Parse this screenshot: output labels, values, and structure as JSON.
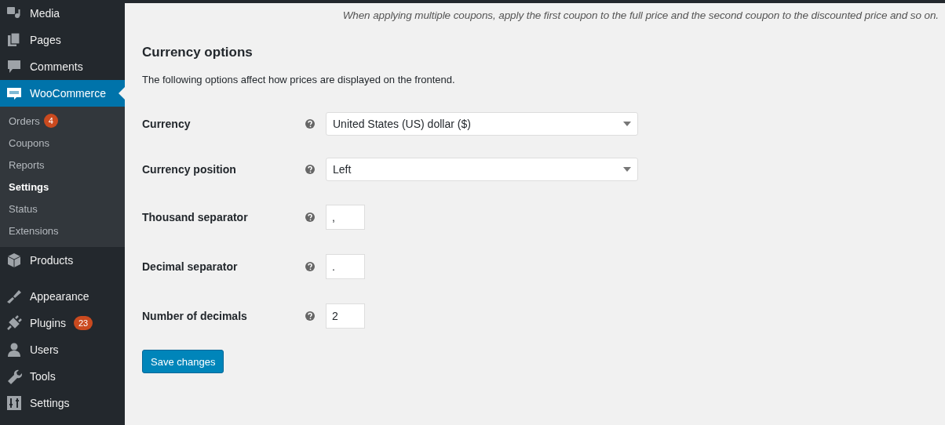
{
  "sidebar": {
    "items": [
      {
        "label": "Media",
        "current": false
      },
      {
        "label": "Pages",
        "current": false
      },
      {
        "label": "Comments",
        "current": false
      },
      {
        "label": "WooCommerce",
        "current": true,
        "submenu": [
          {
            "label": "Orders",
            "selected": false,
            "badge": "4"
          },
          {
            "label": "Coupons",
            "selected": false
          },
          {
            "label": "Reports",
            "selected": false
          },
          {
            "label": "Settings",
            "selected": true
          },
          {
            "label": "Status",
            "selected": false
          },
          {
            "label": "Extensions",
            "selected": false
          }
        ]
      },
      {
        "label": "Products",
        "current": false
      },
      {
        "label": "Appearance",
        "current": false
      },
      {
        "label": "Plugins",
        "current": false,
        "badge": "23"
      },
      {
        "label": "Users",
        "current": false
      },
      {
        "label": "Tools",
        "current": false
      },
      {
        "label": "Settings",
        "current": false
      }
    ]
  },
  "main": {
    "note": "When applying multiple coupons, apply the first coupon to the full price and the second coupon to the discounted price and so on.",
    "section": {
      "title": "Currency options",
      "description": "The following options affect how prices are displayed on the frontend.",
      "fields": [
        {
          "label": "Currency",
          "kind": "select",
          "value": "United States (US) dollar ($)"
        },
        {
          "label": "Currency position",
          "kind": "select",
          "value": "Left"
        },
        {
          "label": "Thousand separator",
          "kind": "text",
          "value": ","
        },
        {
          "label": "Decimal separator",
          "kind": "text",
          "value": "."
        },
        {
          "label": "Number of decimals",
          "kind": "text",
          "value": "2"
        }
      ]
    },
    "save_button": "Save changes"
  }
}
